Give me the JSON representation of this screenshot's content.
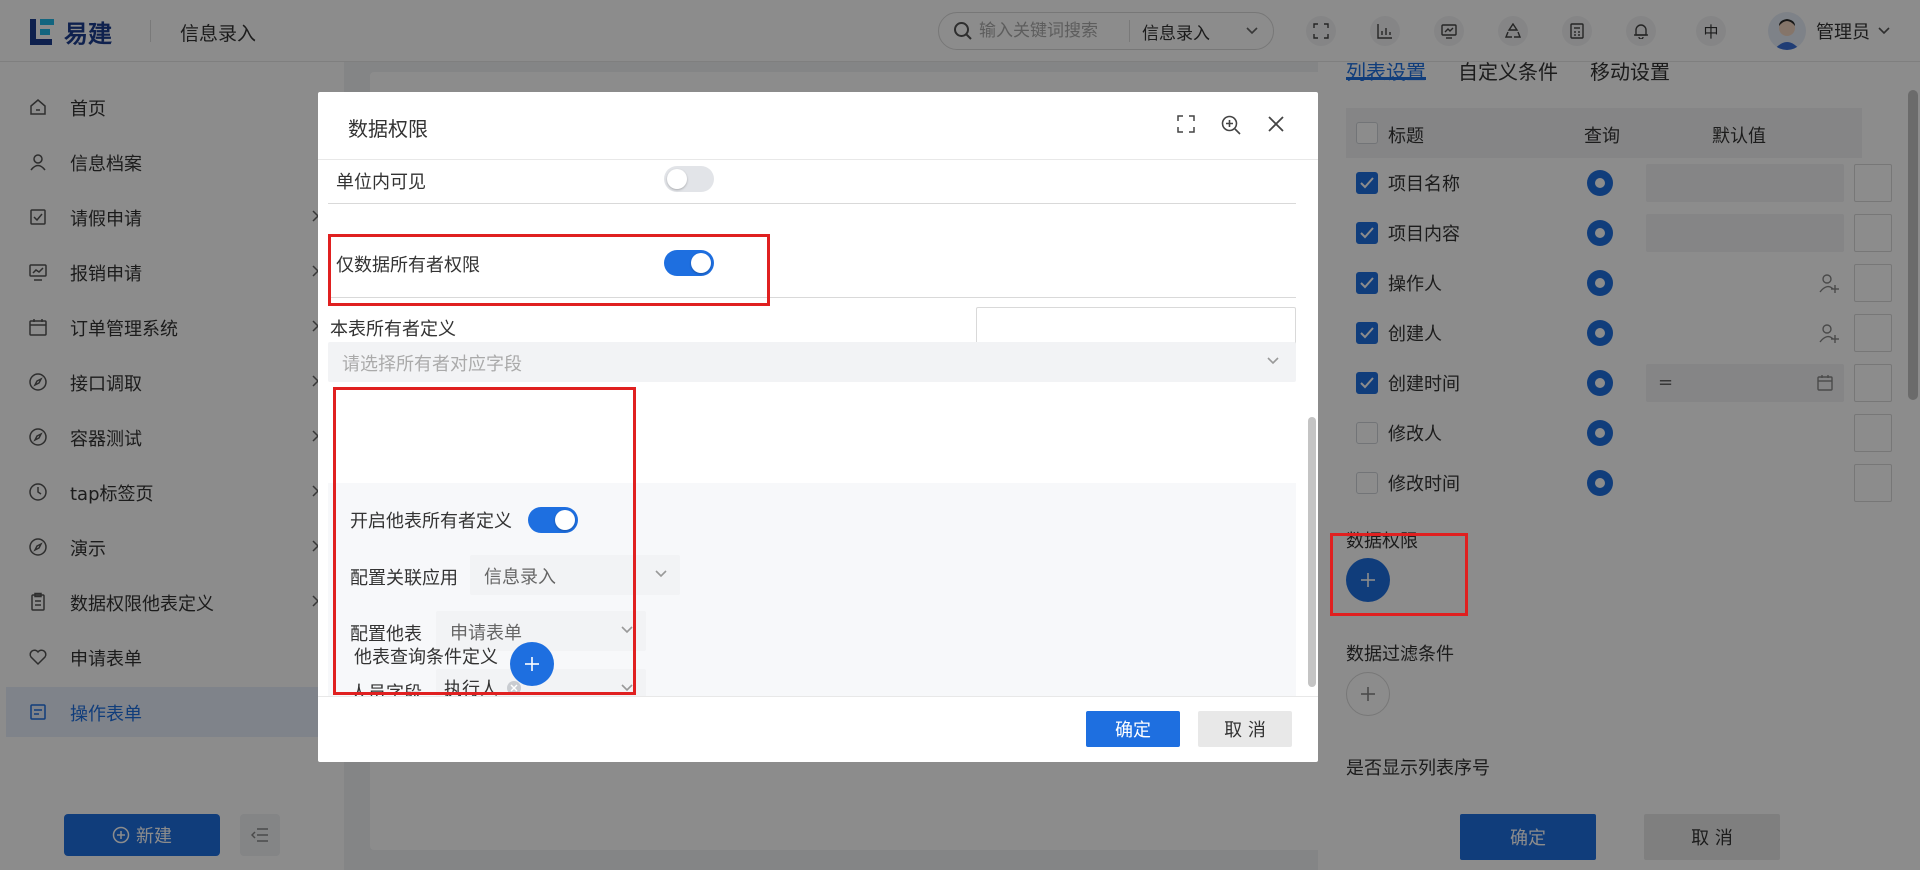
{
  "header": {
    "logo_text": "易建",
    "page_title": "信息录入",
    "search_placeholder": "输入关键词搜索",
    "search_scope": "信息录入",
    "lang_label": "中",
    "user_name": "管理员"
  },
  "sidebar": {
    "items": [
      {
        "label": "首页",
        "icon": "home-icon",
        "has_arrow": false
      },
      {
        "label": "信息档案",
        "icon": "user-icon",
        "has_arrow": false
      },
      {
        "label": "请假申请",
        "icon": "checklist-icon",
        "has_arrow": true
      },
      {
        "label": "报销申请",
        "icon": "monitor-icon",
        "has_arrow": true
      },
      {
        "label": "订单管理系统",
        "icon": "calendar-icon",
        "has_arrow": true
      },
      {
        "label": "接口调取",
        "icon": "compass-icon",
        "has_arrow": true
      },
      {
        "label": "容器测试",
        "icon": "compass-icon",
        "has_arrow": true
      },
      {
        "label": "tap标签页",
        "icon": "clock-icon",
        "has_arrow": true
      },
      {
        "label": "演示",
        "icon": "compass-icon",
        "has_arrow": true
      },
      {
        "label": "数据权限他表定义",
        "icon": "clipboard-icon",
        "has_arrow": true
      },
      {
        "label": "申请表单",
        "icon": "heart-icon",
        "has_arrow": false
      },
      {
        "label": "操作表单",
        "icon": "form-icon",
        "has_arrow": false,
        "active": true
      }
    ],
    "new_button": "新建"
  },
  "right_panel": {
    "tabs": [
      "列表设置",
      "自定义条件",
      "移动设置"
    ],
    "table_headers": {
      "title": "标题",
      "query": "查询",
      "default": "默认值"
    },
    "rows": [
      {
        "label": "项目名称",
        "checked": true,
        "default_kind": "input",
        "default_value": ""
      },
      {
        "label": "项目内容",
        "checked": true,
        "default_kind": "input",
        "default_value": ""
      },
      {
        "label": "操作人",
        "checked": true,
        "default_kind": "user",
        "default_value": ""
      },
      {
        "label": "创建人",
        "checked": true,
        "default_kind": "user",
        "default_value": ""
      },
      {
        "label": "创建时间",
        "checked": true,
        "default_kind": "date",
        "default_value": "="
      },
      {
        "label": "修改人",
        "checked": false,
        "default_kind": "none",
        "default_value": ""
      },
      {
        "label": "修改时间",
        "checked": false,
        "default_kind": "none",
        "default_value": ""
      }
    ],
    "data_permission_label": "数据权限",
    "data_filter_label": "数据过滤条件",
    "show_serial_label": "是否显示列表序号",
    "ok_button": "确定",
    "cancel_button": "取 消"
  },
  "modal": {
    "title": "数据权限",
    "unit_visible_label": "单位内可见",
    "unit_visible_on": false,
    "owner_only_label": "仅数据所有者权限",
    "owner_only_on": true,
    "owner_field_value": "",
    "table_owner_label": "本表所有者定义",
    "owner_select_placeholder": "请选择所有者对应字段",
    "other_table": {
      "enable_label": "开启他表所有者定义",
      "enable_on": true,
      "app_label": "配置关联应用",
      "app_value": "信息录入",
      "table_label": "配置他表",
      "table_value": "申请表单",
      "person_label": "人员字段",
      "person_tag": "执行人",
      "query_label": "他表查询条件定义"
    },
    "ok_button": "确定",
    "cancel_button": "取 消"
  },
  "colors": {
    "primary": "#1e6fe0",
    "annotation": "#e02020",
    "overlay": "rgba(0,0,0,0.45)"
  }
}
